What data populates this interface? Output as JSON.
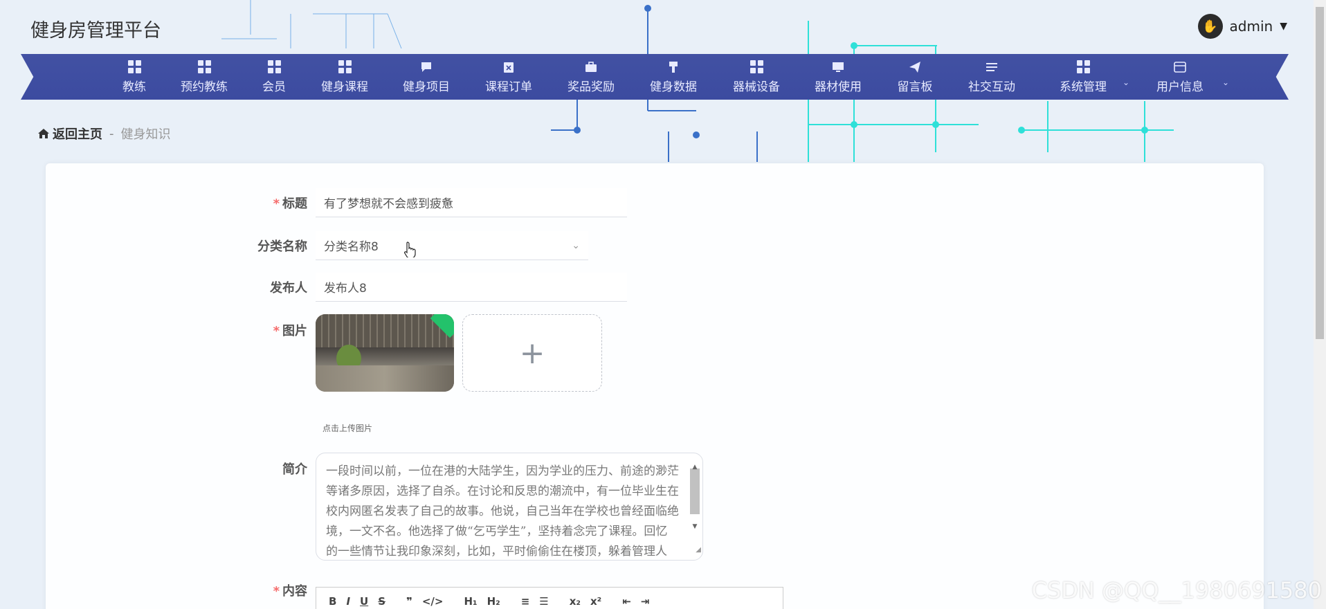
{
  "header": {
    "site_title": "健身房管理平台",
    "user_name": "admin",
    "user_caret": "▼",
    "avatar_icon": "✋"
  },
  "nav": {
    "items": [
      {
        "label": "教练",
        "icon": "grid-icon"
      },
      {
        "label": "预约教练",
        "icon": "grid-icon"
      },
      {
        "label": "会员",
        "icon": "grid-icon"
      },
      {
        "label": "健身课程",
        "icon": "grid-icon"
      },
      {
        "label": "健身项目",
        "icon": "chat-icon"
      },
      {
        "label": "课程订单",
        "icon": "clipboard-icon"
      },
      {
        "label": "奖品奖励",
        "icon": "briefcase-icon"
      },
      {
        "label": "健身数据",
        "icon": "brush-icon"
      },
      {
        "label": "器械设备",
        "icon": "grid-icon"
      },
      {
        "label": "器材使用",
        "icon": "monitor-icon"
      },
      {
        "label": "留言板",
        "icon": "send-icon"
      },
      {
        "label": "社交互动",
        "icon": "list-icon"
      },
      {
        "label": "系统管理",
        "icon": "grid-icon",
        "dropdown": "⌄"
      },
      {
        "label": "用户信息",
        "icon": "wallet-icon",
        "dropdown": "⌄"
      }
    ]
  },
  "breadcrumb": {
    "home_label": "返回主页",
    "separator": "-",
    "current": "健身知识"
  },
  "form": {
    "title": {
      "label": "标题",
      "required": "*",
      "value": "有了梦想就不会感到疲惫"
    },
    "category": {
      "label": "分类名称",
      "value": "分类名称8",
      "chevron": "⌄"
    },
    "publisher": {
      "label": "发布人",
      "value": "发布人8"
    },
    "image": {
      "label": "图片",
      "required": "*",
      "add_symbol": "+",
      "tip": "点击上传图片"
    },
    "summary": {
      "label": "简介",
      "value": "一段时间以前，一位在港的大陆学生，因为学业的压力、前途的渺茫等诸多原因，选择了自杀。在讨论和反思的潮流中，有一位毕业生在校内网匿名发表了自己的故事。他说，自己当年在学校也曾经面临绝境，一文不名。他选择了做“乞丐学生”，坚持着念完了课程。回忆的一些情节让我印象深刻，比如，平时偷偷住在楼顶，躲着管理人员，寒冬腊月，学校里大部分时间都睡"
    },
    "content": {
      "label": "内容",
      "required": "*",
      "toolbar": [
        "B",
        "I",
        "U",
        "S",
        "❞",
        "</>",
        "H₁",
        "H₂",
        "≡",
        "☰",
        "x₂",
        "x²",
        "⇤",
        "⇥"
      ]
    }
  },
  "watermark": "CSDN @QQ__1980691580",
  "colors": {
    "nav_bg": "#3f4ea1",
    "required": "#f56c6c",
    "page_bg": "#e9f0f8"
  }
}
